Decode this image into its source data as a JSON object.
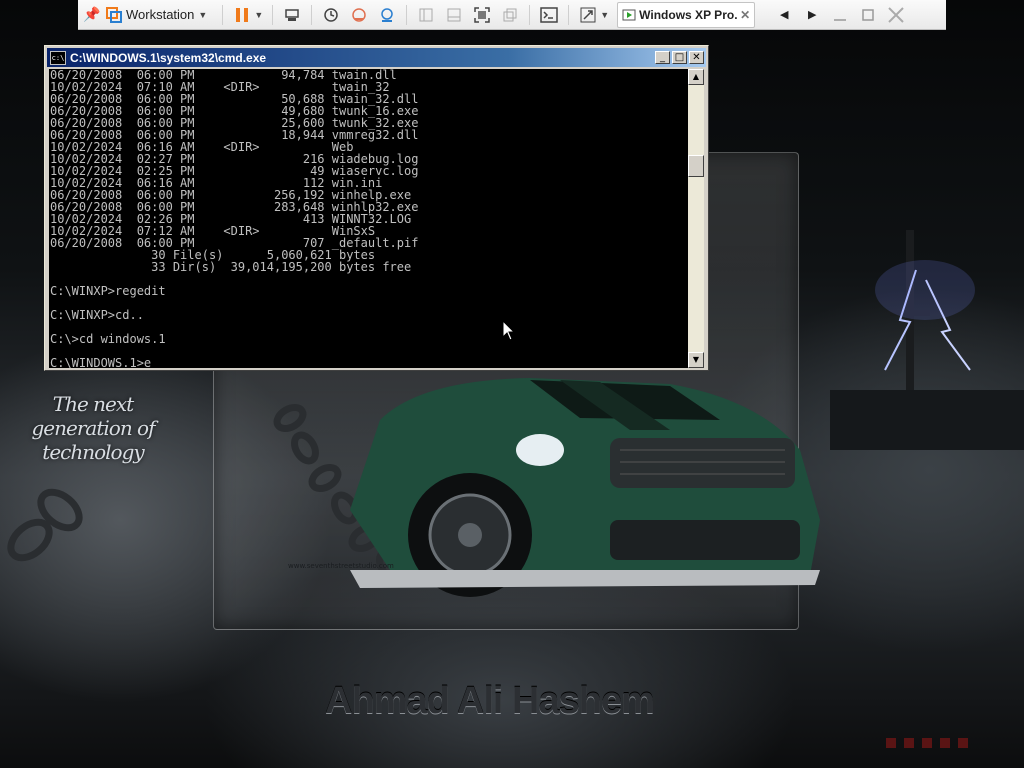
{
  "vmware": {
    "library_label": "Workstation",
    "vm_tab_label": "Windows XP Pro...",
    "vm_tab_close": "✕"
  },
  "cmd": {
    "title": "C:\\WINDOWS.1\\system32\\cmd.exe",
    "icon_text": "c:\\",
    "lines": [
      "06/20/2008  06:00 PM            94,784 twain.dll",
      "10/02/2024  07:10 AM    <DIR>          twain_32",
      "06/20/2008  06:00 PM            50,688 twain_32.dll",
      "06/20/2008  06:00 PM            49,680 twunk_16.exe",
      "06/20/2008  06:00 PM            25,600 twunk_32.exe",
      "06/20/2008  06:00 PM            18,944 vmmreg32.dll",
      "10/02/2024  06:16 AM    <DIR>          Web",
      "10/02/2024  02:27 PM               216 wiadebug.log",
      "10/02/2024  02:25 PM                49 wiaservc.log",
      "10/02/2024  06:16 AM               112 win.ini",
      "06/20/2008  06:00 PM           256,192 winhelp.exe",
      "06/20/2008  06:00 PM           283,648 winhlp32.exe",
      "10/02/2024  02:26 PM               413 WINNT32.LOG",
      "10/02/2024  07:12 AM    <DIR>          WinSxS",
      "06/20/2008  06:00 PM               707 _default.pif",
      "              30 File(s)      5,060,621 bytes",
      "              33 Dir(s)  39,014,195,200 bytes free",
      "",
      "C:\\WINXP>regedit",
      "",
      "C:\\WINXP>cd..",
      "",
      "C:\\>cd windows.1",
      "",
      "C:\\WINDOWS.1>e"
    ]
  },
  "wallpaper": {
    "tagline": "The next generation of technology",
    "signature": "Ahmad Ali Hashem",
    "url": "www.seventhstreetstudio.com"
  },
  "colors": {
    "titlebar_start": "#0a246a",
    "titlebar_end": "#a6caf0",
    "console_text": "#c0c0c0",
    "pause_orange": "#f07a1a",
    "car_green": "#1f4d3c"
  }
}
